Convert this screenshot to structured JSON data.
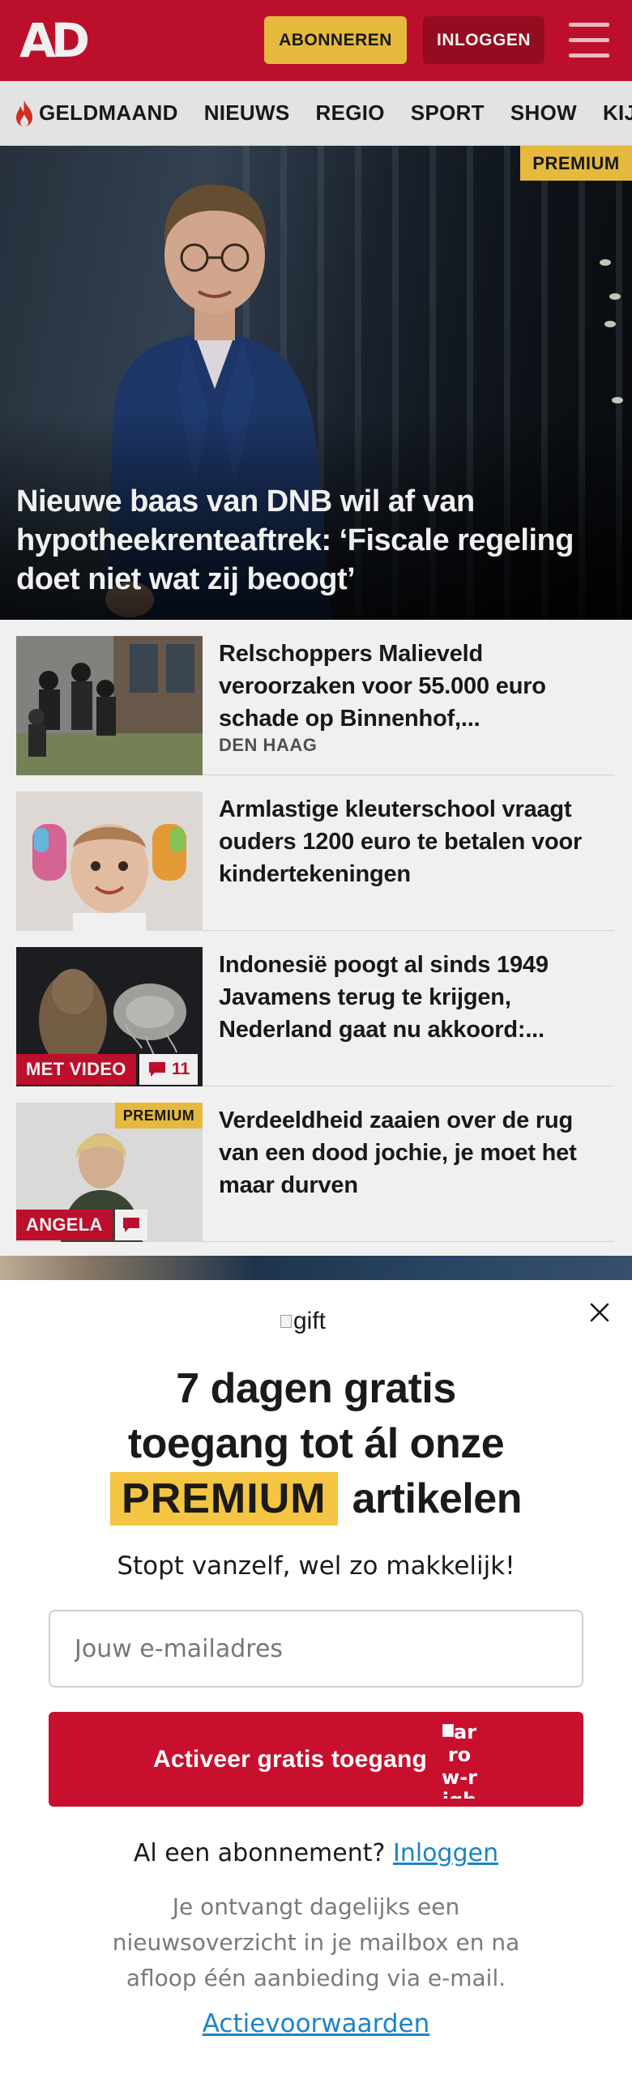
{
  "header": {
    "logo": "AD",
    "subscribe_label": "ABONNEREN",
    "login_label": "INLOGGEN",
    "brand_color": "#c8102e",
    "accent_color": "#f4c542"
  },
  "nav": {
    "items": [
      {
        "label": "GELDMAAND",
        "icon": "flame-icon"
      },
      {
        "label": "NIEUWS"
      },
      {
        "label": "REGIO"
      },
      {
        "label": "SPORT"
      },
      {
        "label": "SHOW"
      },
      {
        "label": "KIJK"
      }
    ]
  },
  "hero": {
    "badge": "PREMIUM",
    "title": "Nieuwe baas van DNB wil af van hypotheekrenteaftrek: ‘Fiscale regeling doet niet wat zij beoogt’"
  },
  "articles": [
    {
      "title": "Relschoppers Malieveld veroorzaken voor 55.000 euro schade op Binnenhof,...",
      "meta": "DEN HAAG"
    },
    {
      "title": "Armlastige kleuterschool vraagt ouders 1200 euro te betalen voor kindertekeningen"
    },
    {
      "title": "Indonesië poogt al sinds 1949 Javamens terug te krijgen, Nederland gaat nu akkoord:...",
      "tag": "MET VIDEO",
      "comments": "11"
    },
    {
      "title": "Verdeeldheid zaaien over de rug van een dood jochie, je moet het maar durven",
      "tag": "ANGELA",
      "badge": "PREMIUM"
    }
  ],
  "modal": {
    "gift_alt": "gift",
    "headline_line1": "7 dagen gratis",
    "headline_line2": "toegang tot ál onze",
    "headline_premium": "PREMIUM",
    "headline_end": "artikelen",
    "subtitle": "Stopt vanzelf, wel zo makkelijk!",
    "email_placeholder": "Jouw e-mailadres",
    "email_value": "",
    "cta_label": "Activeer gratis toegang",
    "cta_arrow_alt": "arrow-right",
    "has_subscription_text": "Al een abonnement?",
    "login_link": "Inloggen",
    "info_text": "Je ontvangt dagelijks een nieuwsoverzicht in je mailbox en na afloop één aanbieding via e-mail.",
    "terms_link": "Actievoorwaarden",
    "link_color": "#1d84c6"
  }
}
